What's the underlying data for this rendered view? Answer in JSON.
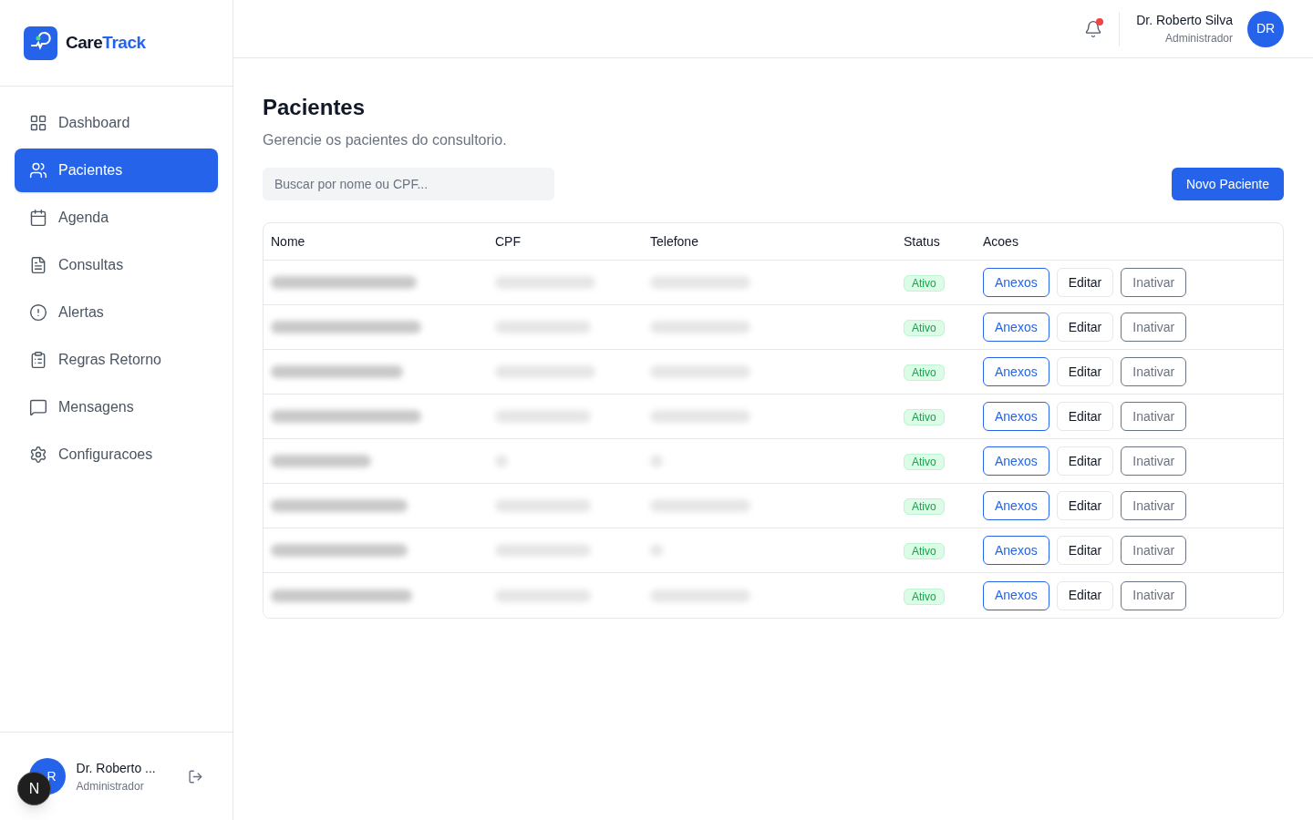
{
  "brand": {
    "part1": "Care",
    "part2": "Track"
  },
  "nav": [
    {
      "label": "Dashboard",
      "selected": false
    },
    {
      "label": "Pacientes",
      "selected": true
    },
    {
      "label": "Agenda",
      "selected": false
    },
    {
      "label": "Consultas",
      "selected": false
    },
    {
      "label": "Alertas",
      "selected": false
    },
    {
      "label": "Regras Retorno",
      "selected": false
    },
    {
      "label": "Mensagens",
      "selected": false
    },
    {
      "label": "Configuracoes",
      "selected": false
    }
  ],
  "sidebar_user": {
    "avatar": "R",
    "name": "Dr. Roberto ...",
    "role": "Administrador",
    "dev_badge": "N"
  },
  "header": {
    "notification": true,
    "name": "Dr. Roberto Silva",
    "role": "Administrador",
    "avatar": "DR"
  },
  "page": {
    "title": "Pacientes",
    "subtitle": "Gerencie os pacientes do consultorio."
  },
  "search": {
    "placeholder": "Buscar por nome ou CPF..."
  },
  "new_button": "Novo Paciente",
  "table": {
    "columns": [
      "Nome",
      "CPF",
      "Telefone",
      "Status",
      "Acoes"
    ],
    "rows": [
      {
        "status": "Ativo",
        "actions": [
          "Anexos",
          "Editar",
          "Inativar"
        ],
        "highlighted": false
      },
      {
        "status": "Ativo",
        "actions": [
          "Anexos",
          "Editar",
          "Inativar"
        ],
        "highlighted": false
      },
      {
        "status": "Ativo",
        "actions": [
          "Anexos",
          "Editar",
          "Inativar"
        ],
        "highlighted": false
      },
      {
        "status": "Ativo",
        "actions": [
          "Anexos",
          "Editar",
          "Inativar"
        ],
        "highlighted": false
      },
      {
        "status": "Ativo",
        "actions": [
          "Anexos",
          "Editar",
          "Inativar"
        ],
        "highlighted": false
      },
      {
        "status": "Ativo",
        "actions": [
          "Anexos",
          "Editar",
          "Inativar"
        ],
        "highlighted": false
      },
      {
        "status": "Ativo",
        "actions": [
          "Anexos",
          "Editar",
          "Inativar"
        ],
        "highlighted": false
      },
      {
        "status": "Ativo",
        "actions": [
          "Anexos",
          "Editar",
          "Inativar"
        ],
        "highlighted": false
      }
    ]
  }
}
